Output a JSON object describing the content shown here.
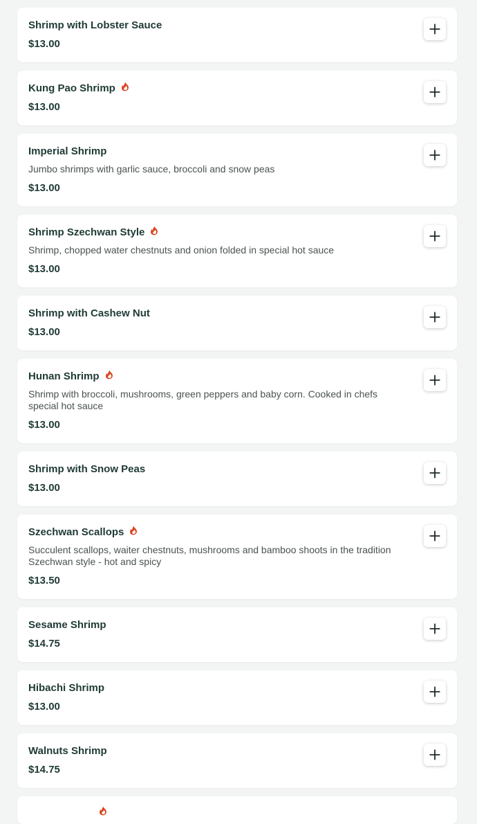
{
  "accent_color": "#1f3a35",
  "spicy_color": "#d9441e",
  "items": [
    {
      "name": "Shrimp with Lobster Sauce",
      "price": "$13.00",
      "description": "",
      "spicy": false
    },
    {
      "name": "Kung Pao Shrimp",
      "price": "$13.00",
      "description": "",
      "spicy": true
    },
    {
      "name": "Imperial Shrimp",
      "price": "$13.00",
      "description": "Jumbo shrimps with garlic sauce, broccoli and snow peas",
      "spicy": false
    },
    {
      "name": "Shrimp Szechwan Style",
      "price": "$13.00",
      "description": "Shrimp, chopped water chestnuts and onion folded in special hot sauce",
      "spicy": true
    },
    {
      "name": "Shrimp with Cashew Nut",
      "price": "$13.00",
      "description": "",
      "spicy": false
    },
    {
      "name": "Hunan Shrimp",
      "price": "$13.00",
      "description": "Shrimp with broccoli, mushrooms, green peppers and baby corn. Cooked in chefs special hot sauce",
      "spicy": true
    },
    {
      "name": "Shrimp with Snow Peas",
      "price": "$13.00",
      "description": "",
      "spicy": false
    },
    {
      "name": "Szechwan Scallops",
      "price": "$13.50",
      "description": "Succulent scallops, waiter chestnuts, mushrooms and bamboo shoots in the tradition Szechwan style - hot and spicy",
      "spicy": true
    },
    {
      "name": "Sesame Shrimp",
      "price": "$14.75",
      "description": "",
      "spicy": false
    },
    {
      "name": "Hibachi Shrimp",
      "price": "$13.00",
      "description": "",
      "spicy": false
    },
    {
      "name": "Walnuts Shrimp",
      "price": "$14.75",
      "description": "",
      "spicy": false
    }
  ],
  "icons": {
    "add": "plus-icon",
    "spicy": "flame-icon"
  }
}
